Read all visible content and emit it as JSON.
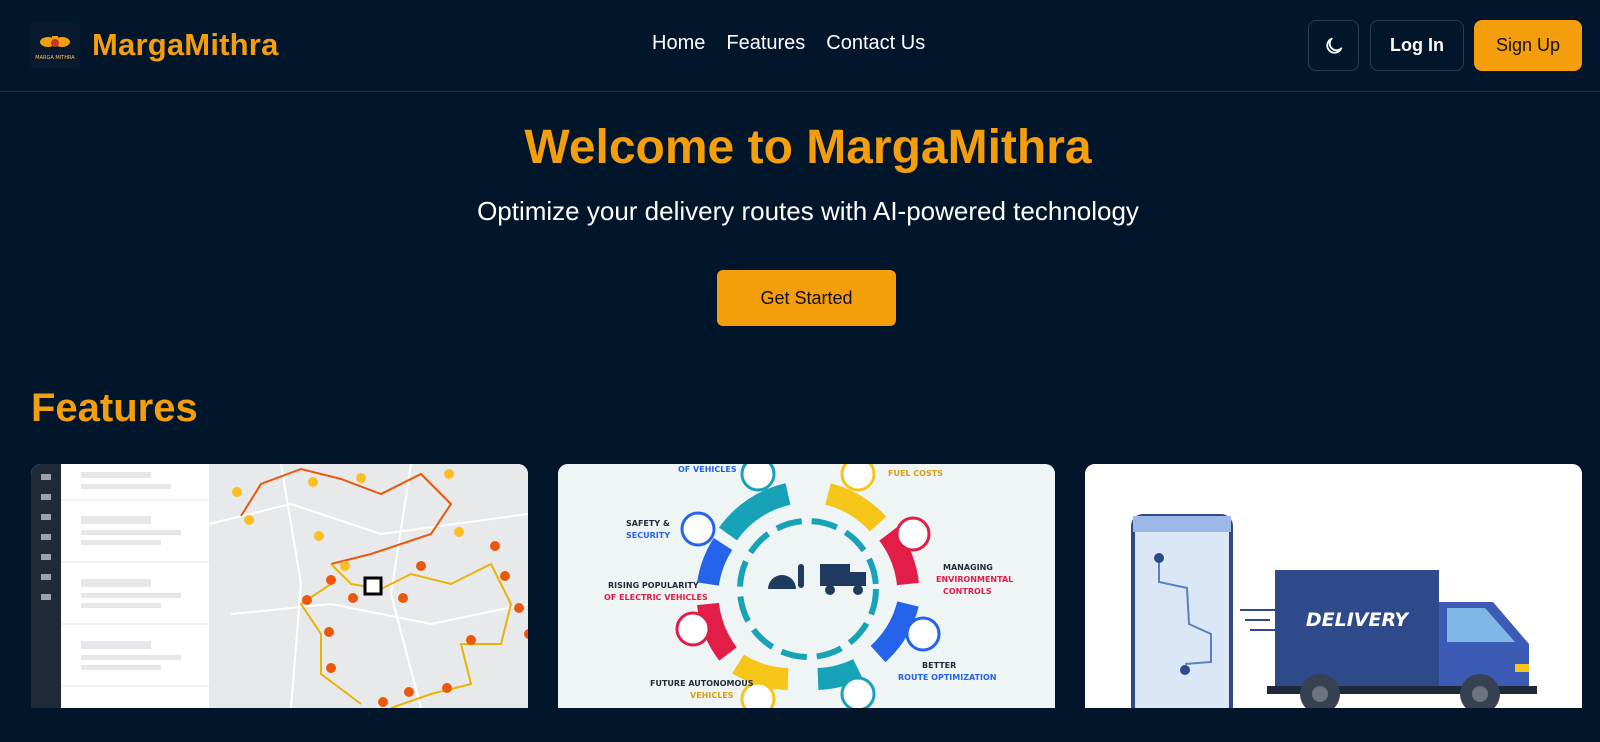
{
  "brand": {
    "name": "MargaMithra",
    "logo_text": "MARGA MITHRA"
  },
  "nav": {
    "items": [
      "Home",
      "Features",
      "Contact Us"
    ]
  },
  "header": {
    "login_label": "Log In",
    "signup_label": "Sign Up",
    "theme_icon": "moon-icon"
  },
  "hero": {
    "title": "Welcome to MargaMithra",
    "subtitle": "Optimize your delivery routes with AI-powered technology",
    "cta_label": "Get Started"
  },
  "features": {
    "title": "Features",
    "card2": {
      "labels": [
        "OF VEHICLES",
        "FUEL COSTS",
        "SAFETY &",
        "SECURITY",
        "MANAGING",
        "ENVIRONMENTAL",
        "CONTROLS",
        "RISING POPULARITY",
        "OF ELECTRIC VEHICLES",
        "BETTER",
        "ROUTE OPTIMIZATION",
        "FUTURE AUTONOMOUS",
        "VEHICLES"
      ]
    },
    "card3": {
      "truck_label": "DELIVERY"
    }
  },
  "colors": {
    "accent": "#f59e0b",
    "background": "#01152b",
    "border": "#2a3b52"
  }
}
